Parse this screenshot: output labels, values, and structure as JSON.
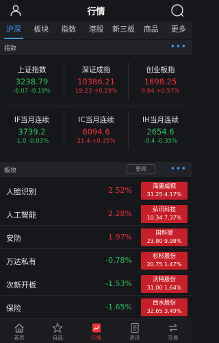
{
  "header": {
    "title": "行情"
  },
  "tabs": [
    {
      "label": "沪深",
      "active": true
    },
    {
      "label": "板块"
    },
    {
      "label": "指数"
    },
    {
      "label": "港股"
    },
    {
      "label": "新三板"
    },
    {
      "label": "商品"
    },
    {
      "label": "更多"
    }
  ],
  "index_section": {
    "title": "指数"
  },
  "indices": [
    {
      "name": "上证指数",
      "value": "3238.79",
      "change": "-6.07 -0.19%",
      "dir": "down"
    },
    {
      "name": "深证成指",
      "value": "10386.21",
      "change": "19.23 +0.19%",
      "dir": "up"
    },
    {
      "name": "创业板指",
      "value": "1698.25",
      "change": "9.64 +0.57%",
      "dir": "up"
    },
    {
      "name": "IF当月连续",
      "value": "3739.2",
      "change": "-1.0 -0.03%",
      "dir": "down"
    },
    {
      "name": "IC当月连续",
      "value": "6094.6",
      "change": "21.4 +0.35%",
      "dir": "up"
    },
    {
      "name": "IH当月连续",
      "value": "2654.6",
      "change": "-9.4 -0.35%",
      "dir": "down"
    }
  ],
  "sector_section": {
    "title": "板块",
    "button": "要闻"
  },
  "sectors": [
    {
      "name": "人脸识别",
      "pct": "2.52%",
      "dir": "up",
      "stock": "海康威视",
      "stock_val": "31.25 4.17%"
    },
    {
      "name": "人工智能",
      "pct": "2.28%",
      "dir": "up",
      "stock": "弘讯科技",
      "stock_val": "10.34 7.37%"
    },
    {
      "name": "安防",
      "pct": "1.97%",
      "dir": "up",
      "stock": "国科微",
      "stock_val": "23.80 9.98%"
    },
    {
      "name": "万达私有",
      "pct": "-0.78%",
      "dir": "down",
      "stock": "杉杉股份",
      "stock_val": "20.75 1.47%"
    },
    {
      "name": "次新开板",
      "pct": "-1.53%",
      "dir": "down",
      "stock": "沃特股份",
      "stock_val": "31.00 1.64%"
    },
    {
      "name": "保险",
      "pct": "-1.65%",
      "dir": "down",
      "stock": "西水股份",
      "stock_val": "32.65 3.49%"
    }
  ],
  "bottom_nav": [
    {
      "label": "首页",
      "icon": "home-icon"
    },
    {
      "label": "自选",
      "icon": "star-icon"
    },
    {
      "label": "行情",
      "icon": "chart-icon",
      "active": true
    },
    {
      "label": "资讯",
      "icon": "news-icon"
    },
    {
      "label": "交易",
      "icon": "trade-icon"
    }
  ],
  "colors": {
    "up": "#f0323c",
    "down": "#2fc25b",
    "accent": "#3fa0ff"
  }
}
